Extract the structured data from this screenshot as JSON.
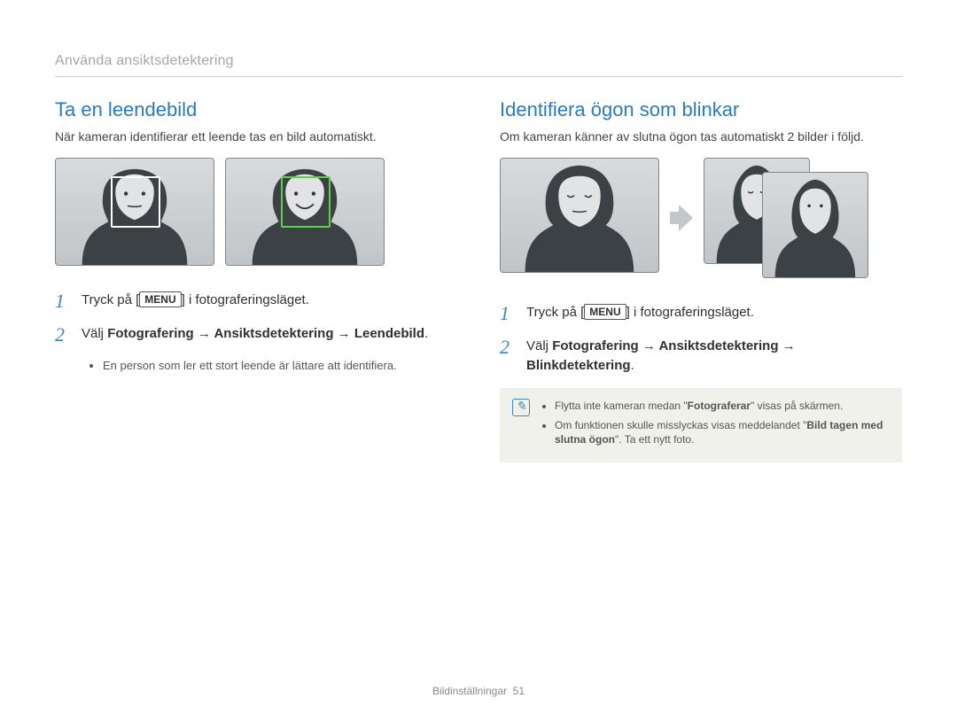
{
  "breadcrumb": "Använda ansiktsdetektering",
  "left": {
    "title": "Ta en leendebild",
    "intro": "När kameran identifierar ett leende tas en bild automatiskt.",
    "step1_prefix": "Tryck på [",
    "step1_key": "MENU",
    "step1_suffix": "] i fotograferingsläget.",
    "step2_prefix": "Välj ",
    "step2_bold": "Fotografering → Ansiktsdetektering → Leendebild",
    "step2_suffix": ".",
    "bullet1": "En person som ler ett stort leende är lättare att identifiera."
  },
  "right": {
    "title": "Identifiera ögon som blinkar",
    "intro": "Om kameran känner av slutna ögon tas automatiskt 2 bilder i följd.",
    "step1_prefix": "Tryck på [",
    "step1_key": "MENU",
    "step1_suffix": "] i fotograferingsläget.",
    "step2_prefix": "Välj ",
    "step2_bold": "Fotografering → Ansiktsdetektering → Blinkdetektering",
    "step2_suffix": ".",
    "note1_a": "Flytta inte kameran medan \"",
    "note1_b": "Fotograferar",
    "note1_c": "\" visas på skärmen.",
    "note2_a": "Om funktionen skulle misslyckas visas meddelandet \"",
    "note2_b": "Bild tagen med slutna ögon",
    "note2_c": "\". Ta ett nytt foto."
  },
  "footer_label": "Bildinställningar",
  "footer_page": "51"
}
